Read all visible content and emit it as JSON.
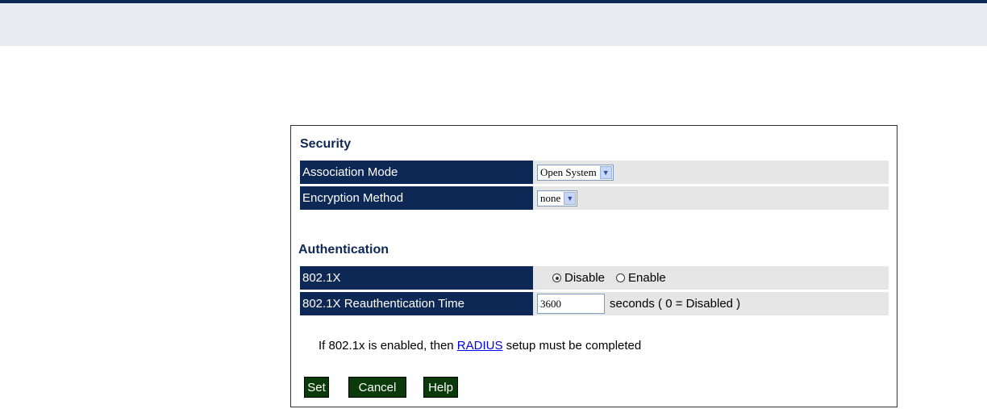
{
  "security": {
    "title": "Security",
    "association_mode": {
      "label": "Association Mode",
      "value": "Open System"
    },
    "encryption_method": {
      "label": "Encryption Method",
      "value": "none"
    }
  },
  "authentication": {
    "title": "Authentication",
    "dot1x": {
      "label": "802.1X",
      "options": [
        "Disable",
        "Enable"
      ],
      "selected": "Disable"
    },
    "reauth": {
      "label": "802.1X Reauthentication Time",
      "value": "3600",
      "unit_text": "seconds ( 0 = Disabled )"
    }
  },
  "note": {
    "prefix": "If 802.1x is enabled, then ",
    "link": "RADIUS",
    "suffix": " setup must be completed"
  },
  "buttons": {
    "set": "Set",
    "cancel": "Cancel",
    "help": "Help"
  },
  "colors": {
    "header_bar": "#0e2856",
    "label_bg": "#0e2856",
    "button_bg": "#0a3a0a",
    "row_bg": "#e6e6e6"
  }
}
